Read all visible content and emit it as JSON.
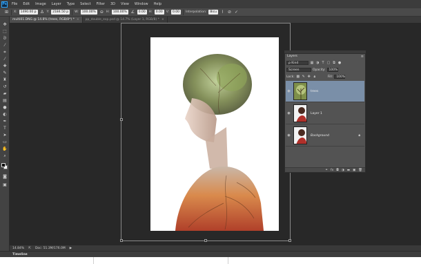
{
  "app": {
    "logo": "Ps",
    "menu": [
      "File",
      "Edit",
      "Image",
      "Layer",
      "Type",
      "Select",
      "Filter",
      "3D",
      "View",
      "Window",
      "Help"
    ]
  },
  "options": {
    "x_label": "X:",
    "x_value": "1490.00 p",
    "y_label": "Y:",
    "y_value": "2184.50 p",
    "w_label": "W:",
    "w_value": "100.00%",
    "h_label": "H:",
    "h_value": "100.00%",
    "angle_value": "0.00",
    "h_skew_label": "H:",
    "h_skew_value": "0.00",
    "v_skew_label": "V:",
    "v_skew_value": "0.00",
    "interpolation_label": "Interpolation:",
    "interpolation_value": "Bicu"
  },
  "tabs": [
    {
      "label": "multi01.DNG @ 14.8% (trees, RGB/8*) *",
      "close": "×"
    },
    {
      "label": "pp_double_exp.psd @ 14.7% (Layer 1, RGB/8) *",
      "close": "×"
    }
  ],
  "status": {
    "zoom": "14.84%",
    "doc": "Doc: 51.3M/176.0M"
  },
  "timeline": {
    "label": "Timeline"
  },
  "layers_panel": {
    "title": "Layers",
    "kind_filter": "ρ Kind",
    "blend_mode": "Screen",
    "opacity_label": "Opacity:",
    "opacity_value": "100%",
    "lock_label": "Lock:",
    "fill_label": "Fill:",
    "fill_value": "100%",
    "layers": [
      {
        "name": "trees",
        "selected": true
      },
      {
        "name": "Layer 1",
        "selected": false
      },
      {
        "name": "Background",
        "selected": false,
        "locked": true
      }
    ],
    "footer_icons": [
      "link-icon",
      "fx-icon",
      "mask-icon",
      "adjustment-icon",
      "folder-icon",
      "new-layer-icon",
      "trash-icon"
    ]
  },
  "colors": {
    "accent": "#31a8ff",
    "selected_layer": "#7a8fa8",
    "workspace": "#282828"
  }
}
